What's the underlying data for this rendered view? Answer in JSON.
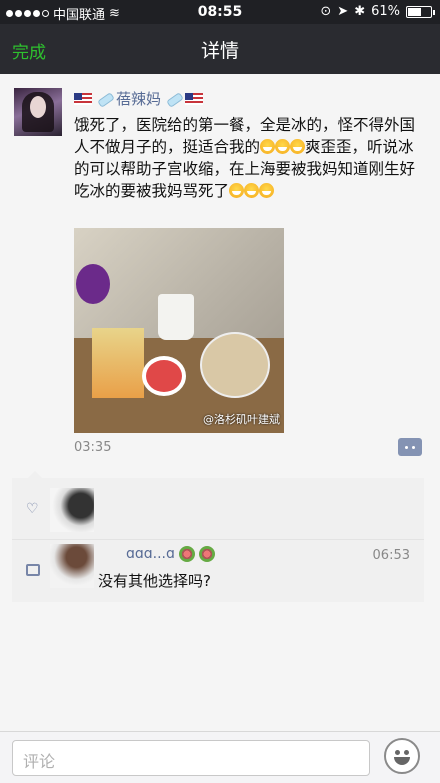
{
  "status": {
    "carrier": "中国联通",
    "time": "08:55",
    "battery": "61%",
    "battery_level": 0.61
  },
  "nav": {
    "done_label": "完成",
    "title": "详情"
  },
  "post": {
    "author": "蓓辣妈",
    "text_line": "饿死了，医院给的第一餐，全是冰的，怪不得外国人不做月子的，挺适合我的",
    "text_line2": "爽歪歪，听说冰的可以帮助子宫收缩，在上海要被我妈知道刚生好吃冰的要被我妈骂死了",
    "image_watermark": "@洛杉矶叶建斌",
    "time": "03:35"
  },
  "comment": {
    "name": "ɑɑɑ...ɑ",
    "time": "06:53",
    "text": "没有其他选择吗?"
  },
  "input": {
    "placeholder": "评论"
  },
  "colors": {
    "accent_green": "#2ec02e",
    "link_blue": "#576b95"
  }
}
